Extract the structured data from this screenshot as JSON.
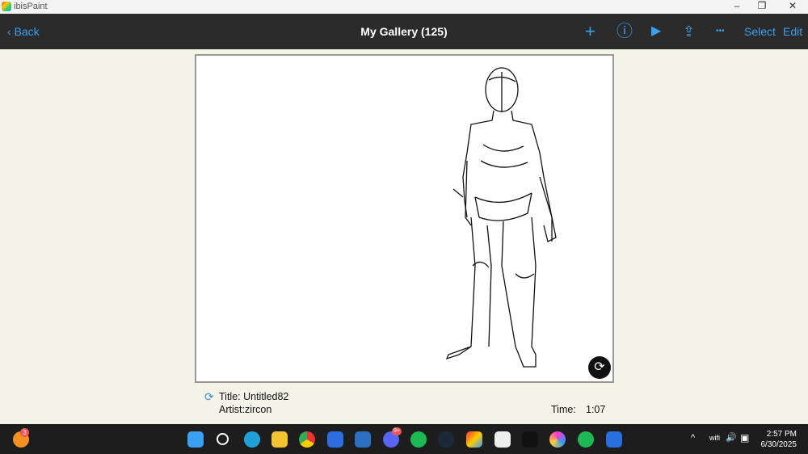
{
  "window": {
    "app_name": "ibisPaint",
    "minimize": "–",
    "restore": "❐",
    "close": "✕"
  },
  "toolbar": {
    "back": "Back",
    "title": "My Gallery (125)",
    "add": "+",
    "info": "ⓘ",
    "play": "▶",
    "share": "⇪",
    "more": "•••",
    "select": "Select",
    "edit": "Edit"
  },
  "artwork": {
    "title_label": "Title: Untitled82",
    "artist_label": "Artist:zircon",
    "time_label": "Time:",
    "time_value": "1:07",
    "rotate": "⟳",
    "sync": "⟳"
  },
  "taskbar": {
    "notification_badge": "3",
    "discord_badge": "9+",
    "clock_time": "2:57 PM",
    "clock_date": "6/30/2025",
    "tray_chevron": "^",
    "tray_wifi": "wifi",
    "tray_volume": "🔊",
    "tray_battery": "▣"
  }
}
